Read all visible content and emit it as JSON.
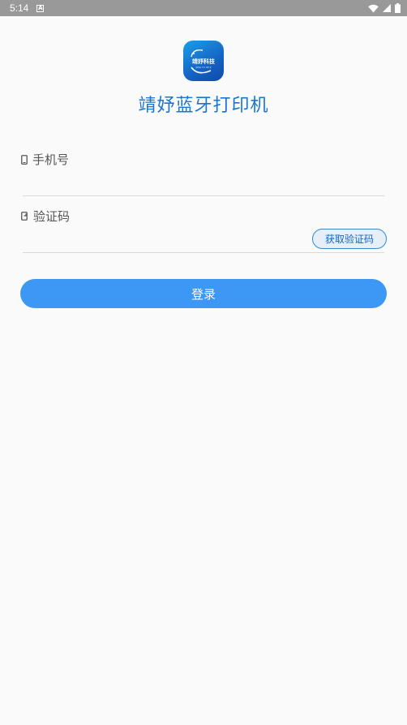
{
  "status_bar": {
    "time": "5:14",
    "notification_icon": "a-notification-icon",
    "wifi_icon": "wifi-icon",
    "signal_icon": "signal-icon",
    "battery_icon": "battery-icon"
  },
  "app": {
    "logo_text": "靖妤科技",
    "logo_subtext": "JING YU KE JI",
    "title": "靖妤蓝牙打印机"
  },
  "form": {
    "phone_label": "手机号",
    "phone_icon": "phone-icon",
    "code_label": "验证码",
    "code_icon": "sms-code-icon",
    "get_code_label": "获取验证码",
    "login_label": "登录"
  },
  "colors": {
    "accent": "#3d98f5",
    "title": "#1976d2",
    "status_bar": "#999999"
  }
}
